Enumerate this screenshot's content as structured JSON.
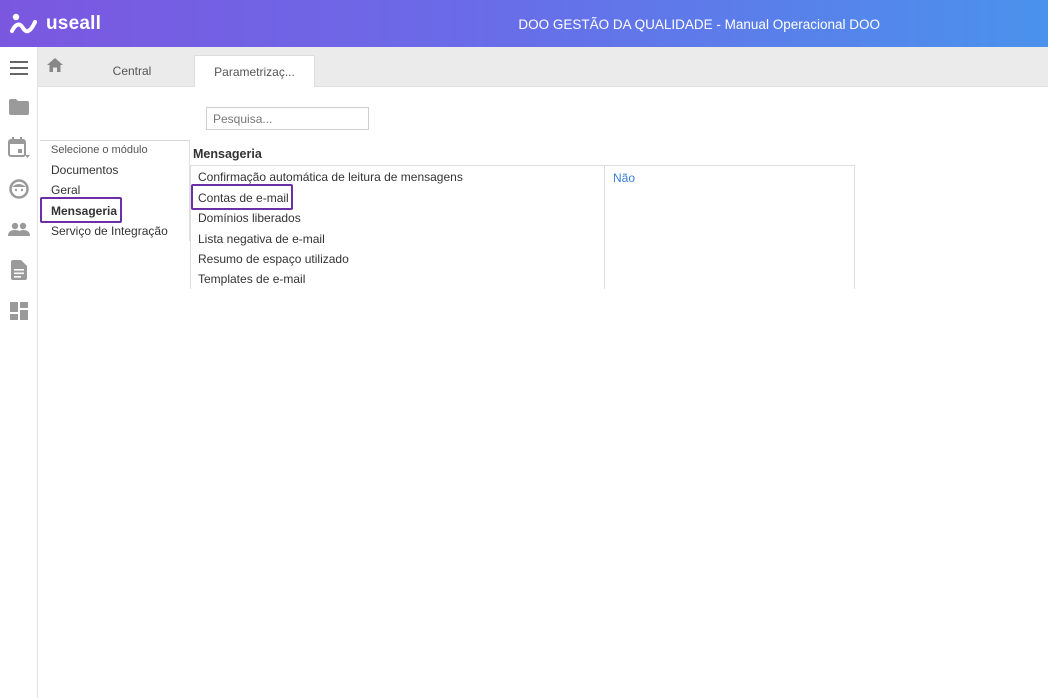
{
  "header": {
    "logo_text": "useall",
    "title": "DOO GESTÃO DA QUALIDADE - Manual Operacional DOO",
    "gradient_start": "#7b57e0",
    "gradient_end": "#4a92ec"
  },
  "rail": {
    "items": [
      {
        "icon": "menu-icon"
      },
      {
        "icon": "folder-icon"
      },
      {
        "icon": "calendar-icon"
      },
      {
        "icon": "face-icon"
      },
      {
        "icon": "people-icon"
      },
      {
        "icon": "document-icon"
      },
      {
        "icon": "dashboard-icon"
      }
    ]
  },
  "tabs": {
    "home_icon": "home-icon",
    "items": [
      {
        "label": "Central"
      },
      {
        "label": "Parametrizaç..."
      }
    ],
    "active_index": 1
  },
  "search": {
    "placeholder": "Pesquisa..."
  },
  "modules": {
    "header": "Selecione o módulo",
    "items": [
      "Documentos",
      "Geral",
      "Mensageria",
      "Serviço de Integração"
    ],
    "selected": "Mensageria",
    "highlight_color": "#6b2fa6"
  },
  "parameters": {
    "section_title": "Mensageria",
    "items": [
      "Confirmação automática de leitura de mensagens",
      "Contas de e-mail",
      "Domínios liberados",
      "Lista negativa de e-mail",
      "Resumo de espaço utilizado",
      "Templates de e-mail"
    ],
    "first_value": "Não",
    "value_color": "#3a7fd5"
  }
}
